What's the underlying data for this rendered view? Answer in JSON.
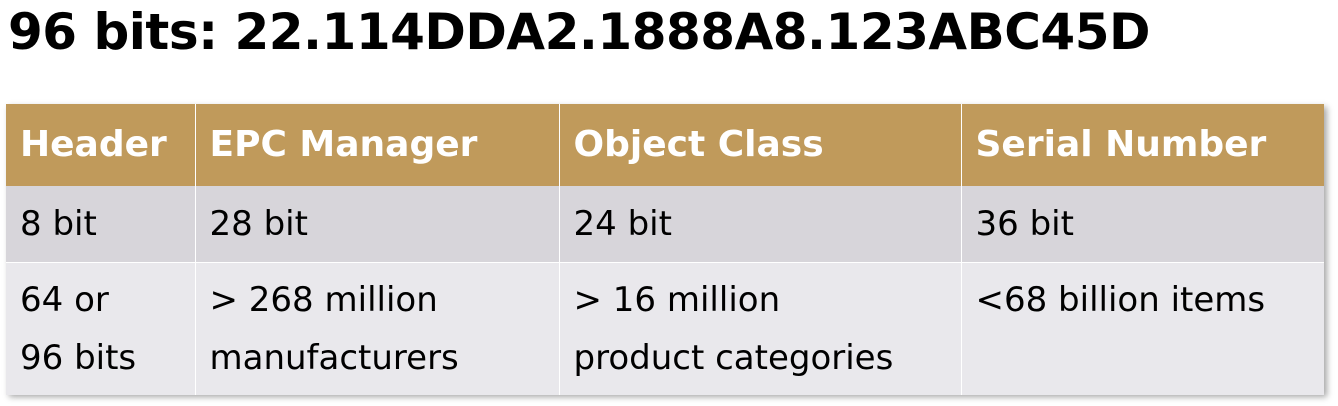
{
  "title": "96 bits: 22.114DDA2.1888A8.123ABC45D",
  "colors": {
    "header_bg": "#c09a5b",
    "header_text": "#ffffff",
    "row1_bg": "#d7d5da",
    "row2_bg": "#e9e8ec"
  },
  "table": {
    "headers": [
      "Header",
      "EPC Manager",
      "Object Class",
      "Serial Number"
    ],
    "rows": [
      [
        "8 bit",
        "28 bit",
        "24 bit",
        "36 bit"
      ],
      [
        [
          "64 or",
          "96 bits"
        ],
        [
          "> 268 million",
          "manufacturers"
        ],
        [
          "> 16 million",
          "product categories"
        ],
        [
          "<68 billion items"
        ]
      ]
    ]
  }
}
